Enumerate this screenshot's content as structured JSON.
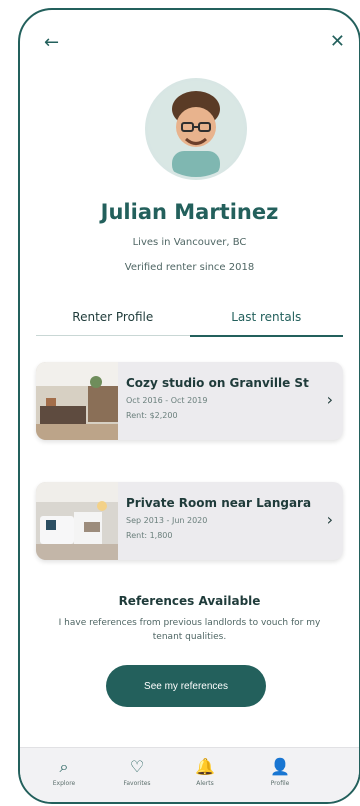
{
  "header": {
    "back_icon": "arrow-left-icon",
    "close_icon": "close-icon"
  },
  "profile": {
    "name": "Julian Martinez",
    "location": "Lives in Vancouver, BC",
    "verified": "Verified renter since 2018"
  },
  "tabs": [
    {
      "label": "Renter Profile"
    },
    {
      "label": "Last rentals"
    }
  ],
  "rentals": [
    {
      "title": "Cozy studio on Granville St",
      "dates": "Oct 2016 - Oct 2019",
      "rent": "Rent: $2,200"
    },
    {
      "title": "Private Room near Langara",
      "dates": "Sep 2013 - Jun 2020",
      "rent": "Rent: 1,800"
    }
  ],
  "references": {
    "title": "References Available",
    "description": "I have references from previous landlords to vouch for my tenant qualities.",
    "button_label": "See my references"
  },
  "bottom_nav": [
    {
      "label": "Explore",
      "icon": "search-icon"
    },
    {
      "label": "Favorites",
      "icon": "heart-icon"
    },
    {
      "label": "Alerts",
      "icon": "bell-icon"
    },
    {
      "label": "Profile",
      "icon": "user-icon"
    }
  ],
  "colors": {
    "accent": "#23605c",
    "card_bg": "#ecebee",
    "text": "#1f3b3a"
  }
}
